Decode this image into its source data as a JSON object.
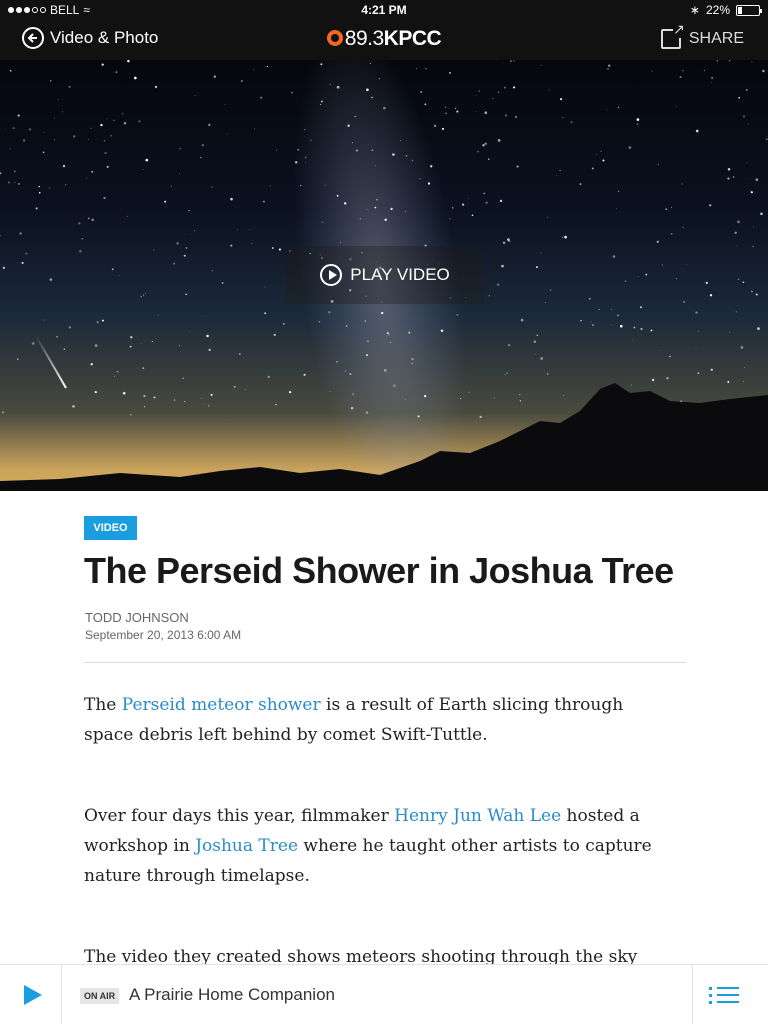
{
  "status": {
    "carrier": "BELL",
    "time": "4:21 PM",
    "battery": "22%",
    "battery_level": 0.22
  },
  "nav": {
    "back_label": "Video & Photo",
    "logo_number": "89.3",
    "logo_name": "KPCC",
    "share_label": "SHARE"
  },
  "hero": {
    "play_label": "PLAY VIDEO"
  },
  "article": {
    "badge": "VIDEO",
    "title": "The Perseid Shower in Joshua Tree",
    "author": "TODD JOHNSON",
    "date": "September 20, 2013 6:00 AM",
    "p1": {
      "pre": "The ",
      "link": "Perseid meteor shower",
      "post": " is a result of Earth slicing through space debris left behind by comet Swift-Tuttle."
    },
    "p2": {
      "pre": "Over four days this year, filmmaker ",
      "link1": "Henry Jun Wah Lee",
      "mid": " hosted a workshop in ",
      "link2": "Joshua Tree",
      "post": " where he taught other artists to capture nature through timelapse."
    },
    "p3": "The video they created shows meteors shooting through the sky"
  },
  "player": {
    "onair": "ON AIR",
    "program": "A Prairie Home Companion"
  },
  "colors": {
    "accent": "#1a9ee0",
    "link": "#2b8bc6",
    "logo_orange": "#f26722",
    "bar": "#111111"
  }
}
